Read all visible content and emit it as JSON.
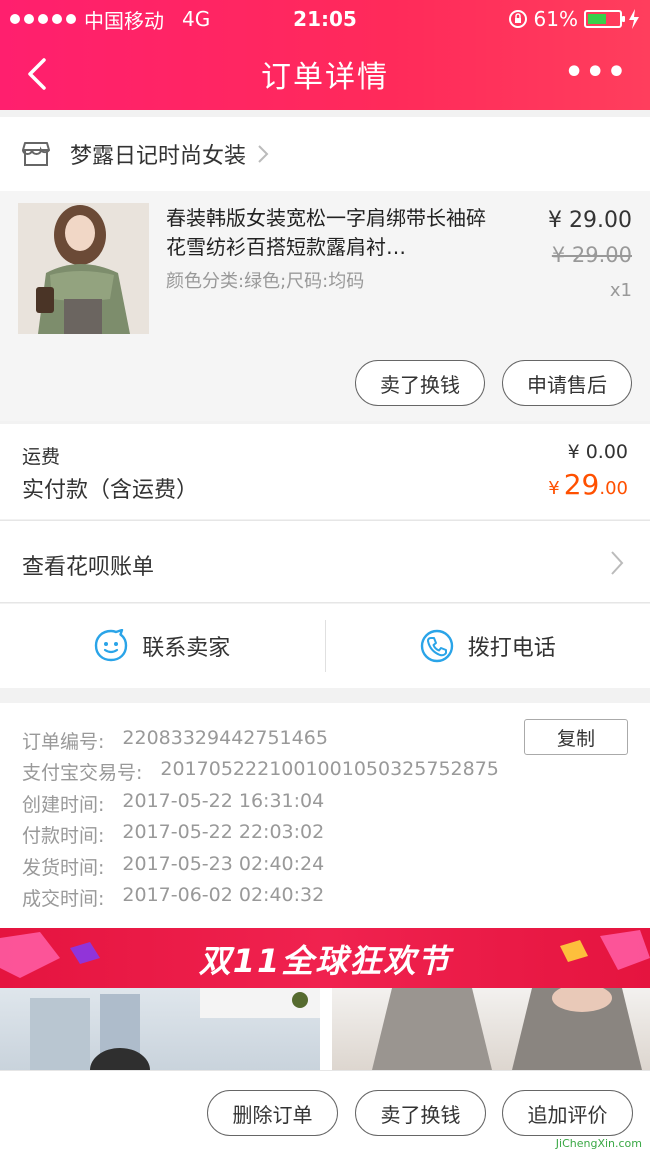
{
  "status_bar": {
    "carrier": "中国移动",
    "network": "4G",
    "time": "21:05",
    "battery": "61%",
    "battery_level": 0.61
  },
  "nav": {
    "title": "订单详情",
    "more": "•••"
  },
  "shop": {
    "name": "梦露日记时尚女装"
  },
  "product": {
    "title": "春装韩版女装宽松一字肩绑带长袖碎花雪纺衫百搭短款露肩衬…",
    "attributes": "颜色分类:绿色;尺码:均码",
    "price": "¥ 29.00",
    "original_price": "¥ 29.00",
    "quantity": "x1",
    "buttons": {
      "sell": "卖了换钱",
      "after_sale": "申请售后"
    }
  },
  "fees": {
    "shipping_label": "运费",
    "shipping_value": "¥ 0.00",
    "paid_label": "实付款（含运费）",
    "paid_symbol": "¥",
    "paid_int": "29",
    "paid_dec": ".00"
  },
  "huabei": {
    "label": "查看花呗账单"
  },
  "contact": {
    "seller": "联系卖家",
    "phone": "拨打电话"
  },
  "order_info": {
    "copy_label": "复制",
    "rows": [
      {
        "label": "订单编号:",
        "value": "22083329442751465"
      },
      {
        "label": "支付宝交易号:",
        "value": "2017052221001001050325752875"
      },
      {
        "label": "创建时间:",
        "value": "2017-05-22 16:31:04"
      },
      {
        "label": "付款时间:",
        "value": "2017-05-22 22:03:02"
      },
      {
        "label": "发货时间:",
        "value": "2017-05-23 02:40:24"
      },
      {
        "label": "成交时间:",
        "value": "2017-06-02 02:40:32"
      }
    ]
  },
  "banner": {
    "title": "双11全球狂欢节"
  },
  "bottom_bar": {
    "delete": "删除订单",
    "sell": "卖了换钱",
    "review": "追加评价"
  },
  "watermark": "JiChengXin.com",
  "colors": {
    "brand": "#ff2a5a",
    "price_accent": "#ff5000",
    "icon_blue": "#2aa4e8"
  }
}
